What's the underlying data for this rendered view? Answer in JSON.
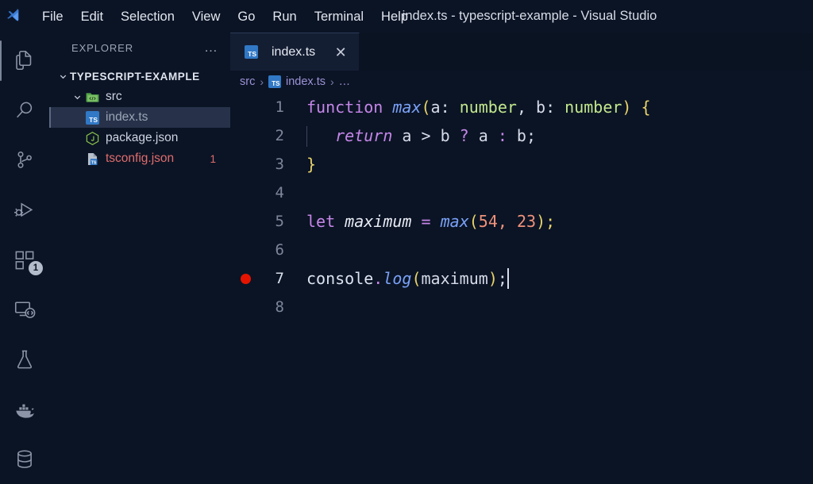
{
  "window": {
    "title": "index.ts - typescript-example - Visual Studio",
    "logo_icon": "vscode-logo-icon"
  },
  "menubar": {
    "items": [
      {
        "label": "File"
      },
      {
        "label": "Edit"
      },
      {
        "label": "Selection"
      },
      {
        "label": "View"
      },
      {
        "label": "Go"
      },
      {
        "label": "Run"
      },
      {
        "label": "Terminal"
      },
      {
        "label": "Help"
      }
    ]
  },
  "activitybar": {
    "items": [
      {
        "name": "explorer",
        "icon": "files-icon",
        "active": true,
        "badge": ""
      },
      {
        "name": "search",
        "icon": "search-icon",
        "active": false,
        "badge": ""
      },
      {
        "name": "source-control",
        "icon": "source-control-icon",
        "active": false,
        "badge": ""
      },
      {
        "name": "run-and-debug",
        "icon": "run-and-debug-icon",
        "active": false,
        "badge": ""
      },
      {
        "name": "extensions",
        "icon": "extensions-icon",
        "active": false,
        "badge": "1"
      },
      {
        "name": "remote-explorer",
        "icon": "remote-explorer-icon",
        "active": false,
        "badge": ""
      },
      {
        "name": "testing",
        "icon": "beaker-icon",
        "active": false,
        "badge": ""
      },
      {
        "name": "docker",
        "icon": "docker-whale-icon",
        "active": false,
        "badge": ""
      },
      {
        "name": "database",
        "icon": "database-icon",
        "active": false,
        "badge": ""
      }
    ]
  },
  "sidebar": {
    "title": "EXPLORER",
    "more_actions": "…",
    "root": {
      "label": "TYPESCRIPT-EXAMPLE",
      "expanded": true
    },
    "tree": [
      {
        "label": "src",
        "icon": "folder-src-icon",
        "type": "folder",
        "expanded": true,
        "selected": false,
        "badge": ""
      },
      {
        "label": "index.ts",
        "icon": "typescript-file-icon",
        "type": "file",
        "selected": true,
        "badge": ""
      },
      {
        "label": "package.json",
        "icon": "nodejs-file-icon",
        "type": "file",
        "selected": false,
        "badge": ""
      },
      {
        "label": "tsconfig.json",
        "icon": "tsconfig-file-icon",
        "type": "file",
        "selected": false,
        "badge": "1",
        "error": true
      }
    ]
  },
  "editor": {
    "tabs": [
      {
        "label": "index.ts",
        "icon": "typescript-file-icon",
        "active": true,
        "close_label": "✕"
      }
    ],
    "breadcrumb": {
      "folder": "src",
      "separator": "›",
      "file": "index.ts",
      "symbol": "…"
    },
    "lines": [
      {
        "number": "1",
        "breakpoint": false,
        "active": false
      },
      {
        "number": "2",
        "breakpoint": false,
        "active": false
      },
      {
        "number": "3",
        "breakpoint": false,
        "active": false
      },
      {
        "number": "4",
        "breakpoint": false,
        "active": false
      },
      {
        "number": "5",
        "breakpoint": false,
        "active": false
      },
      {
        "number": "6",
        "breakpoint": false,
        "active": false
      },
      {
        "number": "7",
        "breakpoint": true,
        "active": true
      },
      {
        "number": "8",
        "breakpoint": false,
        "active": false
      }
    ],
    "code": {
      "l1": {
        "kw_function": "function",
        "fn_max": "max",
        "paren_open": "(",
        "param_a": "a",
        "colon1": ": ",
        "type1": "number",
        "comma": ", ",
        "param_b": "b",
        "colon2": ": ",
        "type2": "number",
        "paren_close": ")",
        "brace_open": " {"
      },
      "l2": {
        "kw_return": "return",
        "var_a": " a ",
        "op_gt": ">",
        "var_b": " b ",
        "op_question": "?",
        "var_a2": " a ",
        "op_colon": ":",
        "var_b2": " b;"
      },
      "l3": {
        "brace_close": "}"
      },
      "l5": {
        "kw_let": "let",
        "var_maximum": "maximum",
        "op_eq": "=",
        "fn_max": "max",
        "paren_open": "(",
        "num1": "54",
        "comma": ", ",
        "num2": "23",
        "paren_close": ")",
        "semi": ";"
      },
      "l7": {
        "obj_console": "console",
        "dot": ".",
        "fn_log": "log",
        "paren_open": "(",
        "arg_maximum": "maximum",
        "paren_close": ")",
        "semi": ";"
      }
    }
  },
  "colors": {
    "editor_background": "#0b1425",
    "sidebar_background": "#0b1425",
    "tab_active_background": "#141e33",
    "selection_background": "#27324a",
    "breakpoint_red": "#e51400",
    "error_red": "#e06c6c",
    "keyword_purple": "#c586e8",
    "function_blue": "#7aa2f7",
    "type_green": "#c3e88d",
    "number_orange": "#f0927a",
    "bracket_yellow": "#e8d36a",
    "breadcrumb_lavender": "#9d92d6",
    "typescript_blue": "#3178c6"
  }
}
